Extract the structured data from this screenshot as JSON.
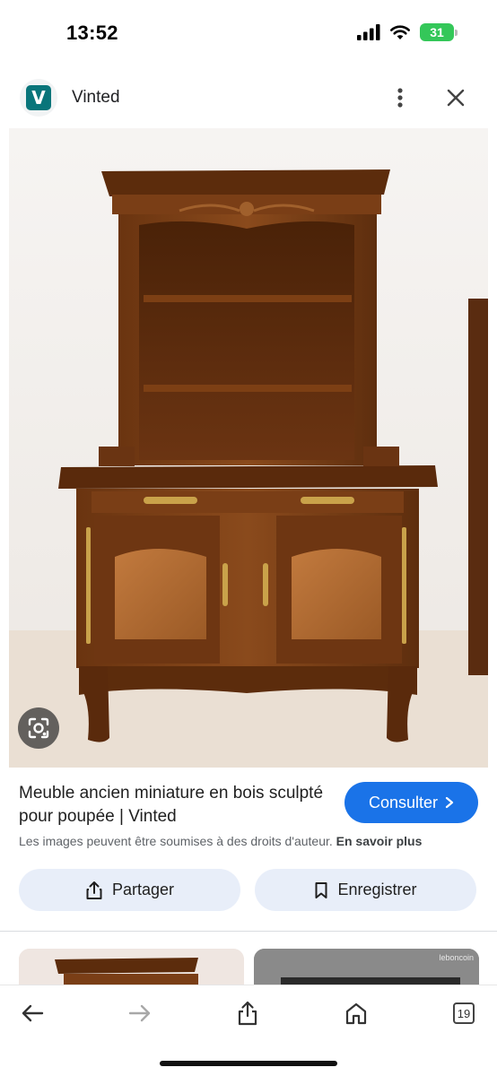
{
  "status_bar": {
    "time": "13:52",
    "battery": "31",
    "icons": [
      "signal-icon",
      "wifi-icon",
      "battery-icon"
    ]
  },
  "header": {
    "site_logo_letter": "V",
    "site_name": "Vinted",
    "icons": [
      "more-vert-icon",
      "close-icon"
    ]
  },
  "result": {
    "title": "Meuble ancien miniature en bois sculpté pour poupée | Vinted",
    "consult_label": "Consulter",
    "copyright_text": "Les images peuvent être soumises à des droits d'auteur.",
    "learn_more": "En savoir plus"
  },
  "actions": {
    "share_label": "Partager",
    "save_label": "Enregistrer"
  },
  "related": {
    "thumb2_source": "leboncoin"
  },
  "toolbar": {
    "tab_count": "19",
    "icons": [
      "back-arrow-icon",
      "forward-arrow-icon",
      "share-icon",
      "home-icon",
      "tabs-icon"
    ]
  },
  "colors": {
    "accent": "#1a73e8",
    "chip_bg": "#e8eef9",
    "vinted_teal": "#09757a",
    "battery_green": "#34c759"
  }
}
